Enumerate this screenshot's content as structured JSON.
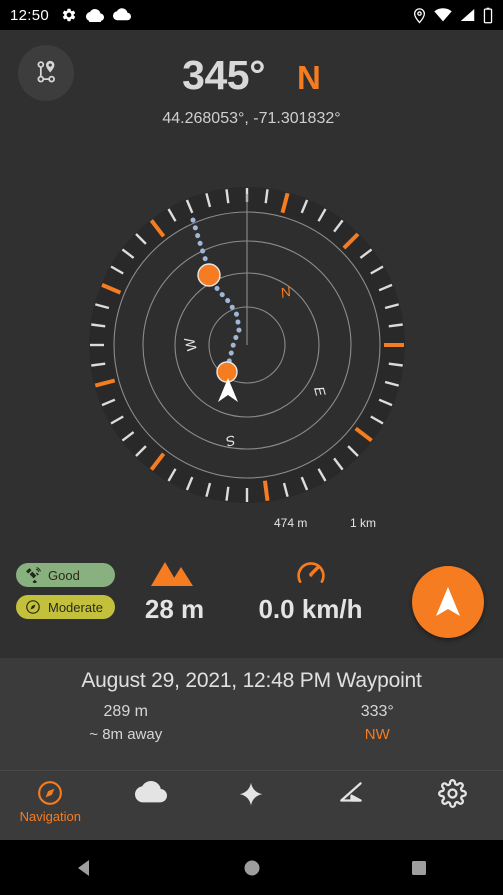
{
  "status_bar": {
    "time": "12:50",
    "left_icons": [
      "gear-icon",
      "cloud-filled-icon",
      "cloud-icon"
    ],
    "right_icons": [
      "location-pin-icon",
      "wifi-icon",
      "signal-icon",
      "battery-icon"
    ]
  },
  "header": {
    "route_button_icon": "waypoints-route-icon",
    "bearing_degrees": "345°",
    "bearing_cardinal": "N",
    "coordinates": "44.268053°,  -71.301832°"
  },
  "compass": {
    "inner_range_label": "474 m",
    "outer_range_label": "1 km",
    "cardinals": [
      {
        "label": "N",
        "color": "#f57c20"
      },
      {
        "label": "W",
        "color": "#e6e6e6"
      },
      {
        "label": "S",
        "color": "#e6e6e6"
      },
      {
        "label": "E",
        "color": "#e6e6e6"
      }
    ],
    "heading_rotation_degrees": -15,
    "track_color": "#9fb6d8",
    "waypoint_color": "#f57c20",
    "self_marker": "navigation-arrow-icon"
  },
  "stats": {
    "badges": [
      {
        "label": "Good",
        "icon": "satellite-icon",
        "color": "#89b07f"
      },
      {
        "label": "Moderate",
        "icon": "compass-icon",
        "color": "#c3c13c"
      }
    ],
    "elevation": {
      "icon": "mountain-icon",
      "value": "28 m"
    },
    "speed": {
      "icon": "speedometer-icon",
      "value": "0.0 km/h"
    },
    "fab_icon": "navigation-arrow-icon"
  },
  "waypoint": {
    "title": "August 29, 2021, 12:48 PM Waypoint",
    "distance": "289 m",
    "distance_note": "~ 8m away",
    "bearing": "333°",
    "bearing_cardinal": "NW"
  },
  "bottom_nav": {
    "items": [
      {
        "label": "Navigation",
        "icon": "compass-icon",
        "active": true
      },
      {
        "label": "",
        "icon": "cloud-icon",
        "active": false
      },
      {
        "label": "",
        "icon": "star-four-point-icon",
        "active": false
      },
      {
        "label": "",
        "icon": "inclinometer-angle-icon",
        "active": false
      },
      {
        "label": "",
        "icon": "gear-icon",
        "active": false
      }
    ]
  },
  "android_nav": {
    "back": "back-triangle-icon",
    "home": "home-circle-icon",
    "recents": "recents-square-icon"
  },
  "colors": {
    "accent": "#f57c20",
    "background": "#303030",
    "panel": "#3b3b3b"
  }
}
